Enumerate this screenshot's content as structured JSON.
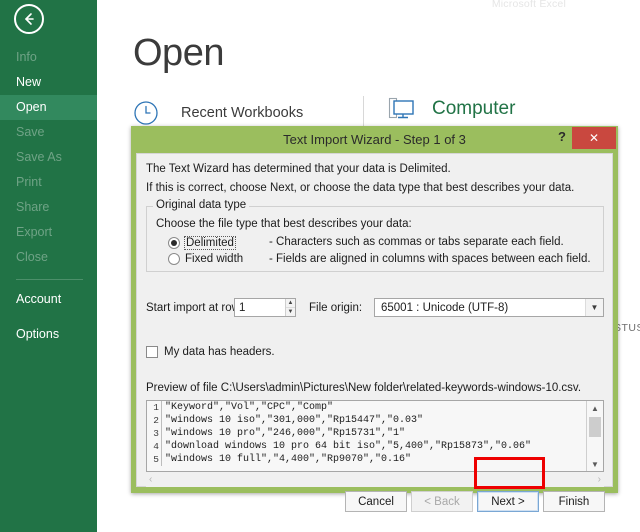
{
  "backstage": {
    "brand": "Microsoft Excel",
    "back_icon": "back-arrow-icon",
    "page_title": "Open",
    "recent": {
      "icon": "clock-icon",
      "label": "Recent Workbooks"
    },
    "computer": {
      "icon": "computer-monitor-icon",
      "label": "Computer"
    },
    "status_fragment": "STUS",
    "rail_items": [
      {
        "label": "Info",
        "state": "dim"
      },
      {
        "label": "New",
        "state": "normal"
      },
      {
        "label": "Open",
        "state": "selected"
      },
      {
        "label": "Save",
        "state": "dim"
      },
      {
        "label": "Save As",
        "state": "dim"
      },
      {
        "label": "Print",
        "state": "dim"
      },
      {
        "label": "Share",
        "state": "dim"
      },
      {
        "label": "Export",
        "state": "dim"
      },
      {
        "label": "Close",
        "state": "dim"
      },
      {
        "label": "Account",
        "state": "normal"
      },
      {
        "label": "Options",
        "state": "normal"
      }
    ]
  },
  "dialog": {
    "title": "Text Import Wizard - Step 1 of 3",
    "help_label": "?",
    "close_label": "✕",
    "intro_line1": "The Text Wizard has determined that your data is Delimited.",
    "intro_line2": "If this is correct, choose Next, or choose the data type that best describes your data.",
    "group": {
      "caption": "Original data type",
      "prompt": "Choose the file type that best describes your data:",
      "options": [
        {
          "label": "Delimited",
          "description": "- Characters such as commas or tabs separate each field.",
          "selected": true,
          "focused": true
        },
        {
          "label": "Fixed width",
          "description": "- Fields are aligned in columns with spaces between each field.",
          "selected": false,
          "focused": false
        }
      ]
    },
    "start_row": {
      "label": "Start import at row:",
      "value": "1"
    },
    "file_origin": {
      "label": "File origin:",
      "value": "65001 : Unicode (UTF-8)"
    },
    "headers_checkbox": {
      "label": "My data has headers.",
      "checked": false
    },
    "preview": {
      "label": "Preview of file C:\\Users\\admin\\Pictures\\New folder\\related-keywords-windows-10.csv.",
      "rows": [
        {
          "n": "1",
          "text": "\"Keyword\",\"Vol\",\"CPC\",\"Comp\""
        },
        {
          "n": "2",
          "text": "\"windows 10 iso\",\"301,000\",\"Rp15447\",\"0.03\""
        },
        {
          "n": "3",
          "text": "\"windows 10 pro\",\"246,000\",\"Rp15731\",\"1\""
        },
        {
          "n": "4",
          "text": "\"download windows 10 pro 64 bit iso\",\"5,400\",\"Rp15873\",\"0.06\""
        },
        {
          "n": "5",
          "text": "\"windows 10 full\",\"4,400\",\"Rp9070\",\"0.16\""
        }
      ],
      "scroll_up": "▲",
      "scroll_down": "▼",
      "scroll_left": "‹",
      "scroll_right": "›"
    },
    "buttons": [
      {
        "label": "Cancel",
        "state": "normal"
      },
      {
        "label": "< Back",
        "state": "disabled"
      },
      {
        "label": "Next >",
        "state": "focused"
      },
      {
        "label": "Finish",
        "state": "normal"
      }
    ]
  },
  "colors": {
    "excel_green": "#217346",
    "dialog_green": "#9bbe5e",
    "close_red": "#c9483f",
    "annotation_red": "#ee0000",
    "selected_rail": "#32895e"
  }
}
